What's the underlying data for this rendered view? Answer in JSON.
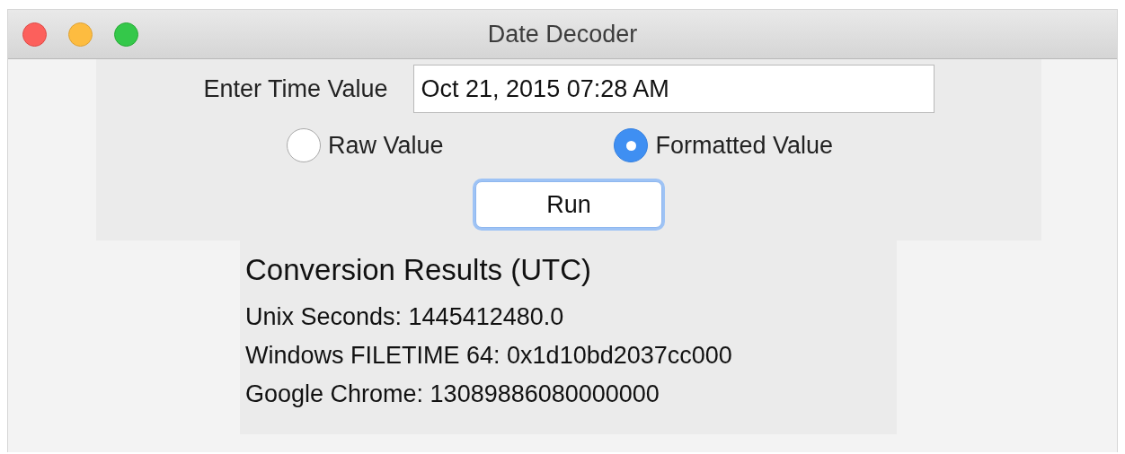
{
  "window": {
    "title": "Date Decoder"
  },
  "input": {
    "label": "Enter Time Value",
    "value": "Oct 21, 2015 07:28 AM"
  },
  "radios": [
    {
      "label": "Raw Value",
      "selected": false
    },
    {
      "label": "Formatted Value",
      "selected": true
    }
  ],
  "run_button": "Run",
  "results": {
    "title": "Conversion Results (UTC)",
    "lines": [
      "Unix Seconds: 1445412480.0",
      "Windows FILETIME 64: 0x1d10bd2037cc000",
      "Google Chrome: 13089886080000000"
    ]
  }
}
